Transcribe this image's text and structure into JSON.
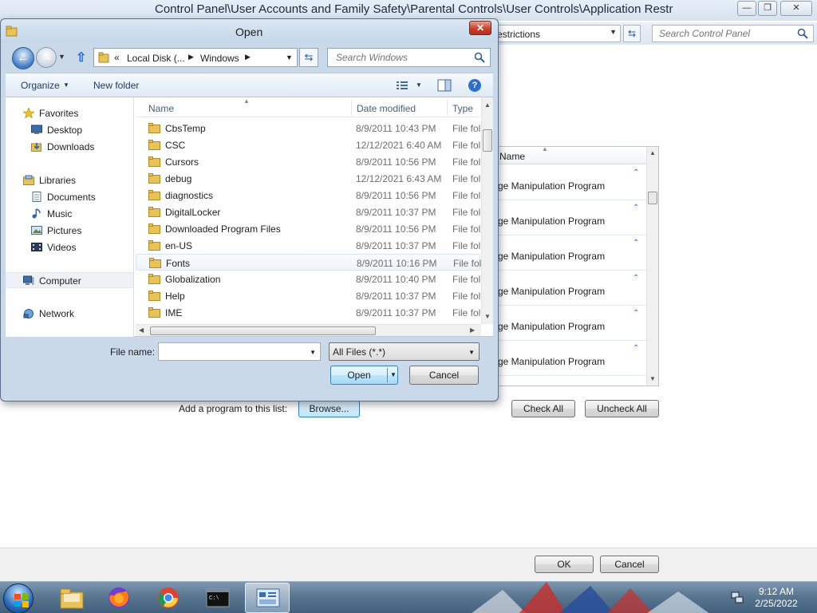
{
  "control_panel": {
    "title": "Control Panel\\User Accounts and Family Safety\\Parental Controls\\User Controls\\Application Restr",
    "address_segment": "estrictions",
    "search_placeholder": "Search Control Panel",
    "list_header": "Name",
    "list_items": [
      "ge Manipulation Program",
      "ge Manipulation Program",
      "ge Manipulation Program",
      "ge Manipulation Program",
      "ge Manipulation Program",
      "ge Manipulation Program"
    ],
    "add_program_label": "Add a program to this list:",
    "browse_label": "Browse...",
    "check_all_label": "Check All",
    "uncheck_all_label": "Uncheck All",
    "ok_label": "OK",
    "cancel_label": "Cancel"
  },
  "dialog": {
    "title": "Open",
    "address": {
      "overflow": "«",
      "segments": [
        "Local Disk (...",
        "Windows"
      ]
    },
    "search_placeholder": "Search Windows",
    "toolbar": {
      "organize": "Organize",
      "new_folder": "New folder"
    },
    "nav": {
      "favorites": "Favorites",
      "desktop": "Desktop",
      "downloads": "Downloads",
      "libraries": "Libraries",
      "documents": "Documents",
      "music": "Music",
      "pictures": "Pictures",
      "videos": "Videos",
      "computer": "Computer",
      "network": "Network"
    },
    "columns": {
      "name": "Name",
      "date_modified": "Date modified",
      "type": "Type"
    },
    "files": [
      {
        "name": "CbsTemp",
        "date": "8/9/2011 10:43 PM",
        "type": "File fol"
      },
      {
        "name": "CSC",
        "date": "12/12/2021 6:40 AM",
        "type": "File fol"
      },
      {
        "name": "Cursors",
        "date": "8/9/2011 10:56 PM",
        "type": "File fol"
      },
      {
        "name": "debug",
        "date": "12/12/2021 6:43 AM",
        "type": "File fol"
      },
      {
        "name": "diagnostics",
        "date": "8/9/2011 10:56 PM",
        "type": "File fol"
      },
      {
        "name": "DigitalLocker",
        "date": "8/9/2011 10:37 PM",
        "type": "File fol"
      },
      {
        "name": "Downloaded Program Files",
        "date": "8/9/2011 10:56 PM",
        "type": "File fol"
      },
      {
        "name": "en-US",
        "date": "8/9/2011 10:37 PM",
        "type": "File fol"
      },
      {
        "name": "Fonts",
        "date": "8/9/2011 10:16 PM",
        "type": "File fol"
      },
      {
        "name": "Globalization",
        "date": "8/9/2011 10:40 PM",
        "type": "File fol"
      },
      {
        "name": "Help",
        "date": "8/9/2011 10:37 PM",
        "type": "File fol"
      },
      {
        "name": "IME",
        "date": "8/9/2011 10:37 PM",
        "type": "File fol"
      }
    ],
    "hovered_file": "Fonts",
    "file_name_label": "File name:",
    "file_name_value": "",
    "filter_value": "All Files (*.*)",
    "open_label": "Open",
    "cancel_label": "Cancel"
  },
  "taskbar": {
    "apps": [
      "windows-explorer",
      "firefox",
      "chrome",
      "command-prompt",
      "control-panel"
    ],
    "active_app": "control-panel",
    "clock_time": "9:12 AM",
    "clock_date": "2/25/2022"
  },
  "colors": {
    "folder": "#e8c35a",
    "accent": "#3c7fb1",
    "close_button": "#c7402c"
  }
}
